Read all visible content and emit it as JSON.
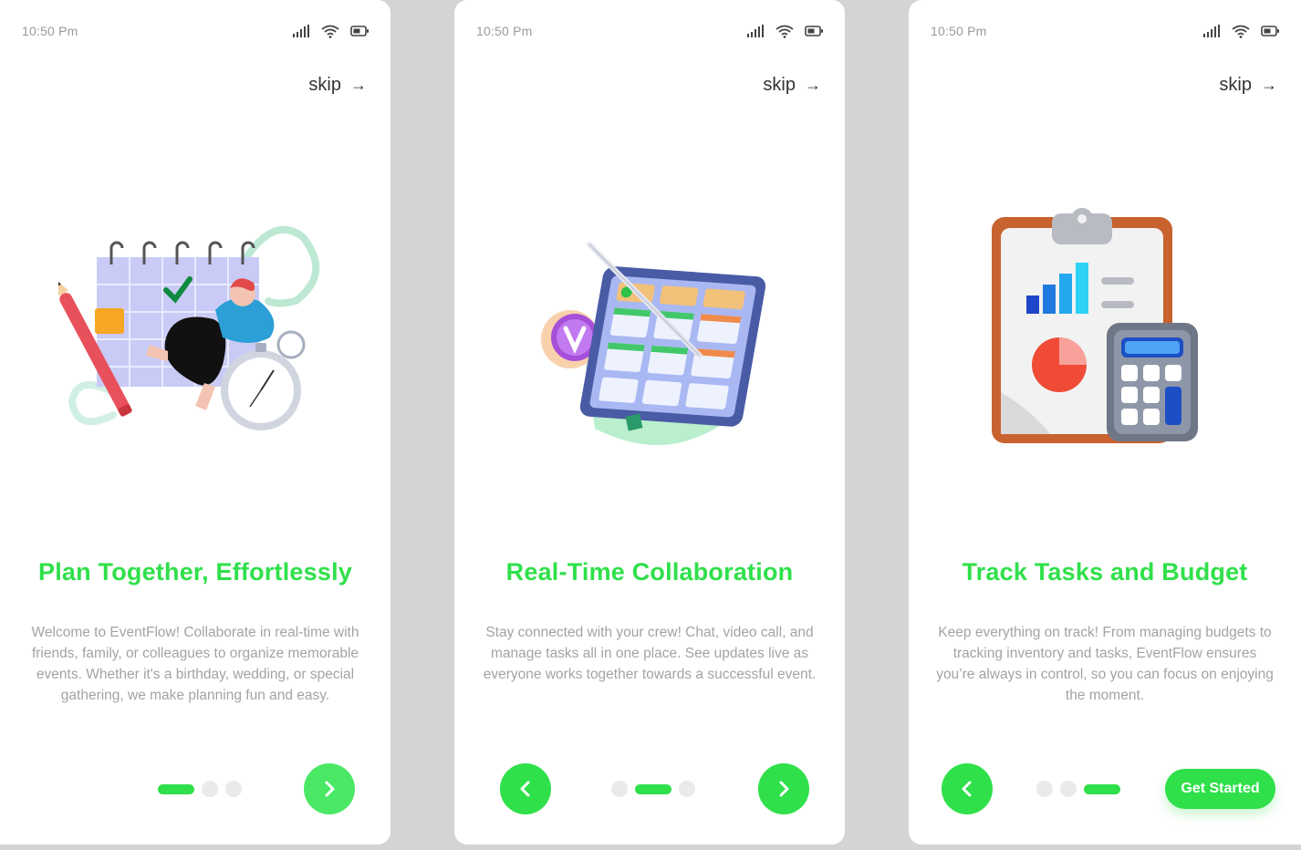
{
  "colors": {
    "accent": "#2fe04a",
    "muted_text": "#a3a3a3",
    "dot_inactive": "#eaeaea",
    "background": "#d4d4d4"
  },
  "screens": [
    {
      "status": {
        "time": "10:50 Pm"
      },
      "skip_label": "skip",
      "title": "Plan Together, Effortlessly",
      "description": "Welcome to EventFlow! Collaborate in real-time with friends, family, or colleagues to organize memorable events. Whether it's a birthday, wedding, or special gathering, we make planning fun and easy.",
      "page_indicator": {
        "current": 1,
        "total": 3
      },
      "illustration": "calendar-person-stopwatch-illustration",
      "next_icon": "chevron-right-icon"
    },
    {
      "status": {
        "time": "10:50 Pm"
      },
      "skip_label": "skip",
      "title": "Real-Time Collaboration",
      "description": "Stay connected with your crew! Chat, video call, and manage tasks all in one place. See updates live as everyone works together towards a successful event.",
      "page_indicator": {
        "current": 2,
        "total": 3
      },
      "illustration": "tablet-task-board-illustration",
      "back_icon": "chevron-left-icon",
      "next_icon": "chevron-right-icon"
    },
    {
      "status": {
        "time": "10:50 Pm"
      },
      "skip_label": "skip",
      "title": "Track Tasks and Budget",
      "description": "Keep everything on track! From managing budgets to tracking inventory and tasks, EventFlow ensures you’re always in control, so you can focus on enjoying the moment.",
      "page_indicator": {
        "current": 3,
        "total": 3
      },
      "illustration": "clipboard-calculator-illustration",
      "back_icon": "chevron-left-icon",
      "cta_label": "Get Started"
    }
  ]
}
